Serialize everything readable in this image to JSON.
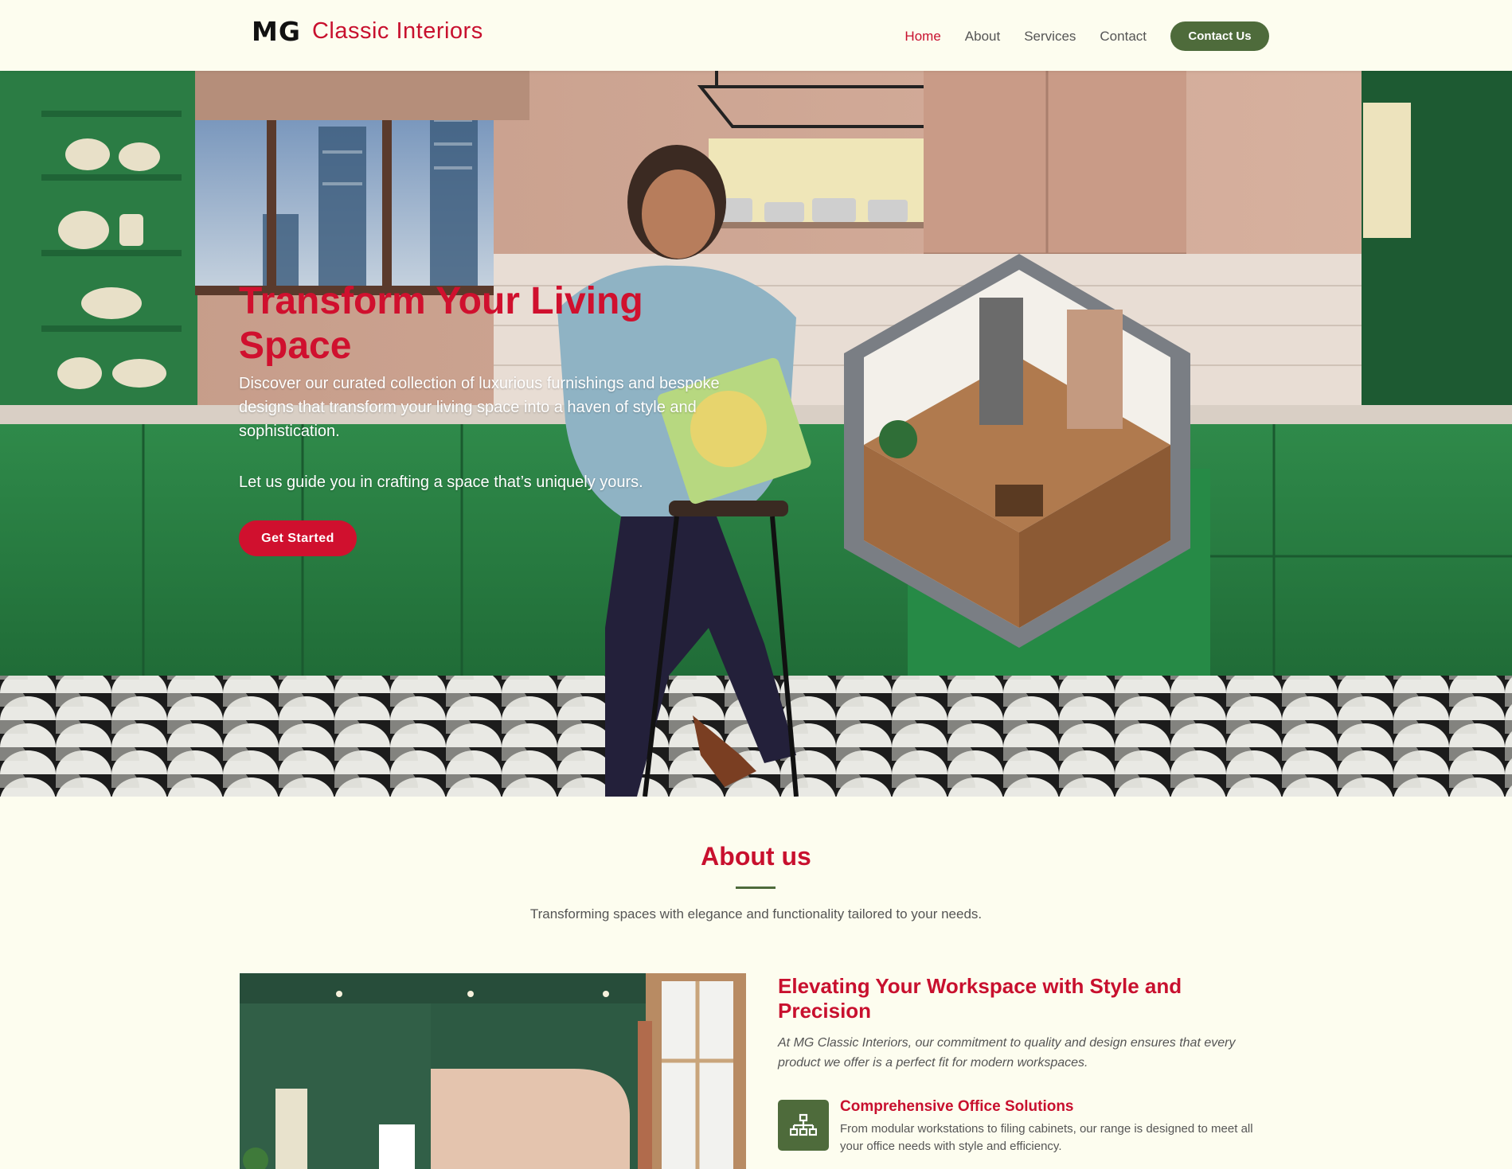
{
  "header": {
    "logo_mark": "MG",
    "logo_text": "Classic Interiors",
    "nav": [
      {
        "label": "Home",
        "active": true
      },
      {
        "label": "About",
        "active": false
      },
      {
        "label": "Services",
        "active": false
      },
      {
        "label": "Contact",
        "active": false
      }
    ],
    "cta_label": "Contact Us"
  },
  "hero": {
    "title": "Transform Your Living Space",
    "description": "Discover our curated collection of luxurious furnishings and bespoke designs that transform your living space into a haven of style and sophistication.",
    "subtext": "Let us guide you in crafting a space that’s uniquely yours.",
    "button_label": "Get Started"
  },
  "about": {
    "title": "About us",
    "subtitle": "Transforming spaces with elegance and functionality tailored to your needs.",
    "heading": "Elevating Your Workspace with Style and Precision",
    "intro": "At MG Classic Interiors, our commitment to quality and design ensures that every product we offer is a perfect fit for modern workspaces.",
    "features": [
      {
        "icon": "sitemap-icon",
        "title": "Comprehensive Office Solutions",
        "description": "From modular workstations to filing cabinets, our range is designed to meet all your office needs with style and efficiency."
      }
    ]
  },
  "colors": {
    "brand_red": "#c8102e",
    "brand_green": "#4e6b3b",
    "background": "#fdfdef"
  }
}
